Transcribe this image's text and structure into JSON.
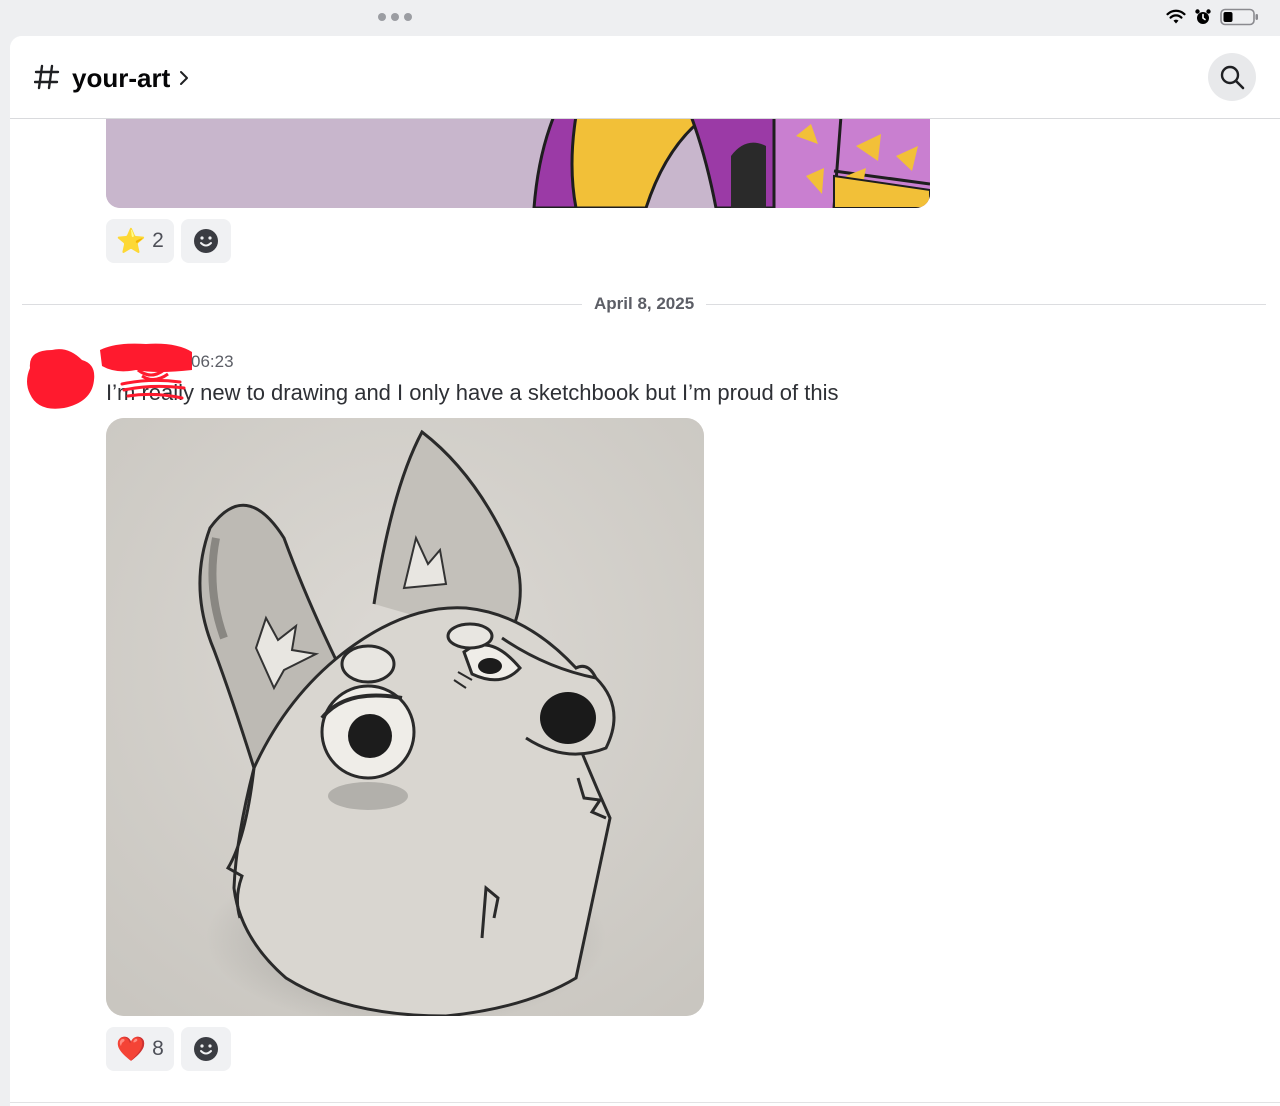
{
  "channel": {
    "name": "your-art"
  },
  "previous_message": {
    "reactions": [
      {
        "emoji": "⭐",
        "count": "2"
      }
    ]
  },
  "date_divider": "April 8, 2025",
  "message": {
    "timestamp": "06:23",
    "text": "I’m really new to drawing and I only have a sketchbook but I’m proud of this",
    "reactions": [
      {
        "emoji": "❤️",
        "count": "8"
      }
    ]
  },
  "colors": {
    "header_text": "#060607",
    "muted_text": "#5c5e66",
    "reaction_bg": "#f0f1f3",
    "redaction": "#ff1a2e"
  }
}
